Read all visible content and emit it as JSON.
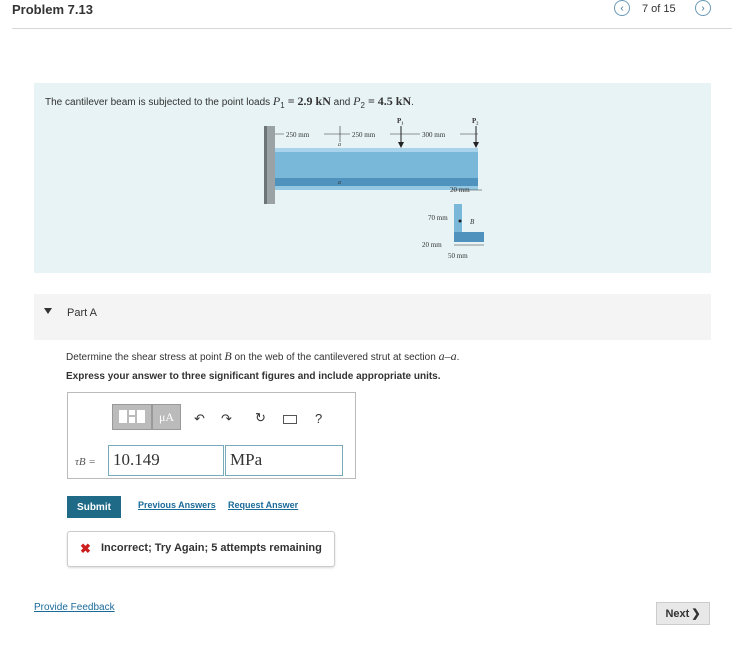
{
  "header": {
    "title": "Problem 7.13",
    "counter": "7 of 15",
    "prev_icon": "chevron-left-icon",
    "next_icon": "chevron-right-icon"
  },
  "problem": {
    "statement_prefix": "The cantilever beam is subjected to the point loads ",
    "p1": "P",
    "p1_sub": "1",
    "p1_value": " = 2.9 kN",
    "and": " and ",
    "p2": "P",
    "p2_sub": "2",
    "p2_value": " = 4.5 kN",
    "end": ".",
    "figure": {
      "dim1": "250 mm",
      "dim2": "250 mm",
      "dim3": "300 mm",
      "load1": "P₁",
      "load2": "P₂",
      "sect_top": "a",
      "sect_bot": "a",
      "flange_thk": "20 mm",
      "height": "70 mm",
      "point": "B",
      "web_thk": "20 mm",
      "width": "50 mm"
    }
  },
  "part": {
    "label": "Part A",
    "question_prefix": "Determine the shear stress at point ",
    "point": "B",
    "question_suffix": " on the web of the cantilevered strut at section ",
    "section": "a–a",
    "question_end": ".",
    "instruction": "Express your answer to three significant figures and include appropriate units."
  },
  "answer": {
    "var_label": "τB =",
    "value": "10.149",
    "units": "MPa",
    "toolbar": {
      "template_icon": "templates-icon",
      "units_label": "μA",
      "undo_icon": "undo-icon",
      "redo_icon": "redo-icon",
      "reset_icon": "reset-icon",
      "keyboard_icon": "keyboard-icon",
      "help_label": "?"
    }
  },
  "actions": {
    "submit": "Submit",
    "previous_answers": "Previous Answers",
    "request_answer": "Request Answer"
  },
  "feedback": {
    "icon": "x-icon",
    "message": "Incorrect; Try Again; 5 attempts remaining"
  },
  "footer": {
    "provide_feedback": "Provide Feedback",
    "next": "Next"
  },
  "colors": {
    "accent": "#1f6b87",
    "problem_bg": "#e7f3f4",
    "error": "#cc1e1e",
    "link": "#1a6a9a"
  }
}
